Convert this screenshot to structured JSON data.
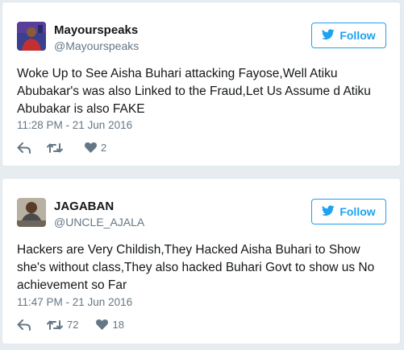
{
  "tweets": [
    {
      "display_name": "Mayourspeaks",
      "handle": "@Mayourspeaks",
      "follow_label": "Follow",
      "text": "Woke Up to See Aisha Buhari attacking Fayose,Well Atiku Abubakar's was also Linked to the Fraud,Let Us Assume d Atiku Abubakar is also FAKE",
      "timestamp": "11:28 PM - 21 Jun 2016",
      "retweets": "",
      "likes": "2"
    },
    {
      "display_name": "JAGABAN",
      "handle": "@UNCLE_AJALA",
      "follow_label": "Follow",
      "text": "Hackers are Very Childish,They Hacked Aisha Buhari to Show she's without class,They also hacked Buhari Govt to show us No achievement so Far",
      "timestamp": "11:47 PM - 21 Jun 2016",
      "retweets": "72",
      "likes": "18"
    }
  ],
  "colors": {
    "background": "#e6ecf0",
    "accent": "#1da1f2",
    "secondary_text": "#657786",
    "action_icon": "#657786"
  },
  "icons": [
    "twitter-bird-icon",
    "reply-icon",
    "retweet-icon",
    "heart-icon"
  ]
}
